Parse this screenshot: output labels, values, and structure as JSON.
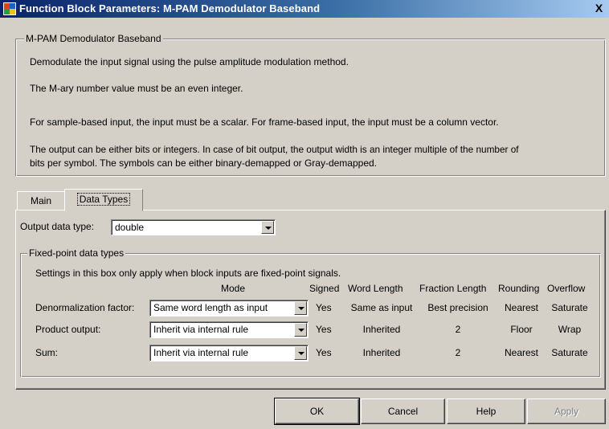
{
  "window": {
    "title": "Function Block Parameters: M-PAM Demodulator Baseband",
    "close_label": "X"
  },
  "description": {
    "group_title": "M-PAM Demodulator Baseband",
    "line1": "Demodulate the input signal using the pulse amplitude modulation method.",
    "line2": "The M-ary number value must be an even integer.",
    "line3": "For sample-based input, the input must be a scalar. For frame-based input, the input must be a column vector.",
    "line4a": "The output can be either bits or integers. In case of bit output, the output width is an integer multiple of the number of",
    "line4b": "bits per symbol. The symbols can be either binary-demapped or Gray-demapped."
  },
  "tabs": [
    {
      "label": "Main"
    },
    {
      "label": "Data Types"
    }
  ],
  "output_data_type": {
    "label": "Output data type:",
    "value": "double"
  },
  "fixed_point": {
    "group_title": "Fixed-point data types",
    "note": "Settings in this box only apply when block inputs are fixed-point signals.",
    "headers": {
      "mode": "Mode",
      "signed": "Signed",
      "word_length": "Word Length",
      "fraction_length": "Fraction Length",
      "rounding": "Rounding",
      "overflow": "Overflow"
    },
    "rows": [
      {
        "label": "Denormalization factor:",
        "mode": "Same word length as input",
        "signed": "Yes",
        "word_length": "Same as input",
        "fraction_length": "Best precision",
        "rounding": "Nearest",
        "overflow": "Saturate"
      },
      {
        "label": "Product output:",
        "mode": "Inherit via internal rule",
        "signed": "Yes",
        "word_length": "Inherited",
        "fraction_length": "2",
        "rounding": "Floor",
        "overflow": "Wrap"
      },
      {
        "label": "Sum:",
        "mode": "Inherit via internal rule",
        "signed": "Yes",
        "word_length": "Inherited",
        "fraction_length": "2",
        "rounding": "Nearest",
        "overflow": "Saturate"
      }
    ]
  },
  "buttons": {
    "ok": "OK",
    "cancel": "Cancel",
    "help": "Help",
    "apply": "Apply"
  }
}
